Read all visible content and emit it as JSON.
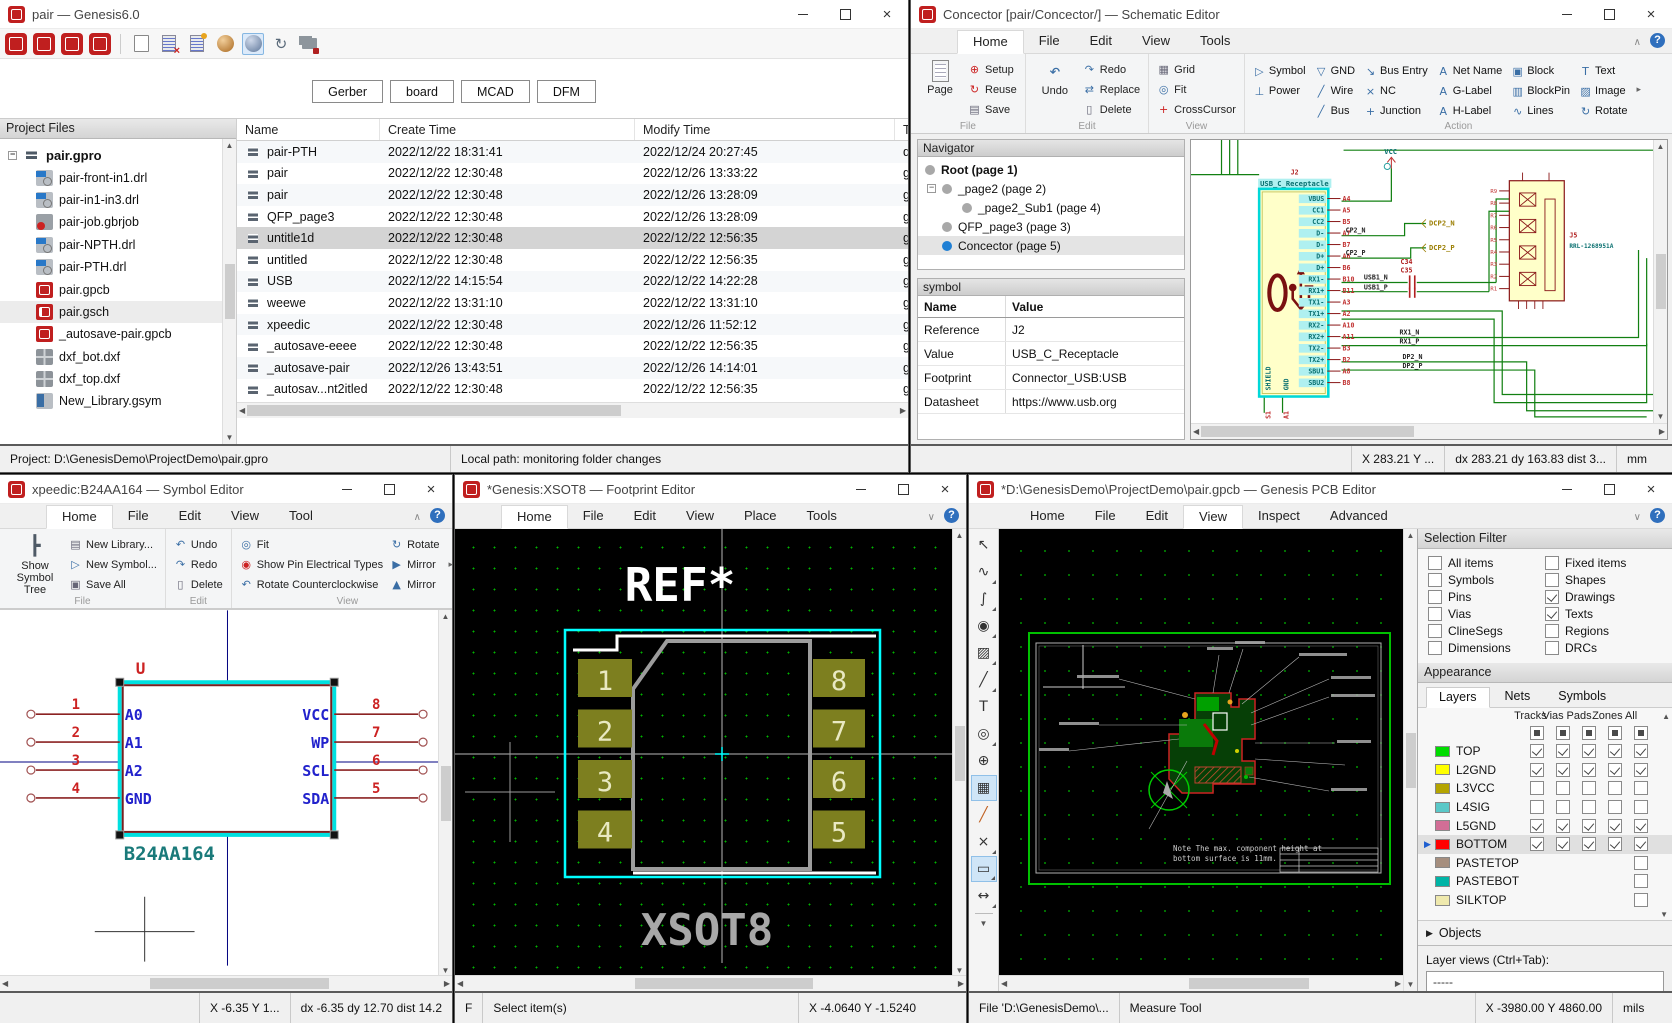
{
  "window_pm": {
    "title": "pair — Genesis6.0",
    "toolbar_actions": [
      "Gerber",
      "board",
      "MCAD",
      "DFM"
    ],
    "left_title": "Project Files",
    "tree": [
      {
        "label": "pair.gpro",
        "icon": "ti-root",
        "cls": "root"
      },
      {
        "label": "pair-front-in1.drl",
        "icon": "ti-drl"
      },
      {
        "label": "pair-in1-in3.drl",
        "icon": "ti-drl"
      },
      {
        "label": "pair-job.gbrjob",
        "icon": "ti-gbr"
      },
      {
        "label": "pair-NPTH.drl",
        "icon": "ti-drl"
      },
      {
        "label": "pair-PTH.drl",
        "icon": "ti-drl"
      },
      {
        "label": "pair.gpcb",
        "icon": "ti-gpcb"
      },
      {
        "label": "pair.gsch",
        "icon": "ti-gsch",
        "cls": "sel"
      },
      {
        "label": "_autosave-pair.gpcb",
        "icon": "ti-gpcb"
      },
      {
        "label": "dxf_bot.dxf",
        "icon": "ti-dxf"
      },
      {
        "label": "dxf_top.dxf",
        "icon": "ti-dxf"
      },
      {
        "label": "New_Library.gsym",
        "icon": "ti-gsym"
      }
    ],
    "table_headers": [
      "Name",
      "Create Time",
      "Modify Time",
      "Type"
    ],
    "table_rows": [
      {
        "name": "pair-PTH",
        "create": "2022/12/22 18:31:41",
        "modify": "2022/12/24 20:27:45",
        "type": "drl File"
      },
      {
        "name": "pair",
        "create": "2022/12/22 12:30:48",
        "modify": "2022/12/26 13:33:22",
        "type": "gpcb File"
      },
      {
        "name": "pair",
        "create": "2022/12/22 12:30:48",
        "modify": "2022/12/26 13:28:09",
        "type": "gsch File"
      },
      {
        "name": "QFP_page3",
        "create": "2022/12/22 12:30:48",
        "modify": "2022/12/26 13:28:09",
        "type": "gsch File"
      },
      {
        "name": "untitle1d",
        "create": "2022/12/22 12:30:48",
        "modify": "2022/12/22 12:56:35",
        "type": "gsch File",
        "cls": "sel"
      },
      {
        "name": "untitled",
        "create": "2022/12/22 12:30:48",
        "modify": "2022/12/22 12:56:35",
        "type": "gsch File"
      },
      {
        "name": "USB",
        "create": "2022/12/22 14:15:54",
        "modify": "2022/12/22 14:22:28",
        "type": "gsch File"
      },
      {
        "name": "weewe",
        "create": "2022/12/22 13:31:10",
        "modify": "2022/12/22 13:31:10",
        "type": "gftp File"
      },
      {
        "name": "xpeedic",
        "create": "2022/12/22 12:30:48",
        "modify": "2022/12/26 11:52:12",
        "type": "gsym File"
      },
      {
        "name": "_autosave-eeee",
        "create": "2022/12/22 12:30:48",
        "modify": "2022/12/22 12:56:35",
        "type": "gsch File"
      },
      {
        "name": "_autosave-pair",
        "create": "2022/12/26 13:43:51",
        "modify": "2022/12/26 14:14:01",
        "type": "gpcb File"
      },
      {
        "name": "_autosav...nt2itled",
        "create": "2022/12/22 12:30:48",
        "modify": "2022/12/22 12:56:35",
        "type": "gsch File"
      }
    ],
    "status_project": "Project: D:\\GenesisDemo\\ProjectDemo\\pair.gpro",
    "status_local": "Local path: monitoring folder changes"
  },
  "window_sch": {
    "title": "Concector [pair/Concector/] — Schematic Editor",
    "tabs": [
      {
        "label": "Home",
        "cls": "active"
      },
      {
        "label": "File"
      },
      {
        "label": "Edit"
      },
      {
        "label": "View"
      },
      {
        "label": "Tools"
      }
    ],
    "ribbon": {
      "page": "Page",
      "setup": "Setup",
      "reuse": "Reuse",
      "save": "Save",
      "file_group": "File",
      "undo": "Undo",
      "redo": "Redo",
      "replace": "Replace",
      "delete": "Delete",
      "edit_group": "Edit",
      "grid": "Grid",
      "fit": "Fit",
      "crosscursor": "CrossCursor",
      "view_group": "View",
      "action_items": [
        {
          "label": "Symbol",
          "g": "▷"
        },
        {
          "label": "Power",
          "g": "⊥",
          "cls": "ddm2"
        },
        {
          "label": "",
          "g": ""
        },
        {
          "label": "GND",
          "g": "▽",
          "cls": "ddm2"
        },
        {
          "label": "Wire",
          "g": "╱"
        },
        {
          "label": "Bus",
          "g": "╱"
        },
        {
          "label": "Bus Entry",
          "g": "↘"
        },
        {
          "label": "NC",
          "g": "×"
        },
        {
          "label": "Junction",
          "g": "+"
        },
        {
          "label": "Net Name",
          "g": "A"
        },
        {
          "label": "G-Label",
          "g": "A"
        },
        {
          "label": "H-Label",
          "g": "A"
        },
        {
          "label": "Block",
          "g": "▣"
        },
        {
          "label": "BlockPin",
          "g": "▥"
        },
        {
          "label": "Lines",
          "g": "∿"
        },
        {
          "label": "Text",
          "g": "T"
        },
        {
          "label": "Image",
          "g": "▨"
        },
        {
          "label": "Rotate",
          "g": "↻"
        }
      ],
      "action_group": "Action"
    },
    "navigator": {
      "title": "Navigator",
      "items": [
        {
          "label": "Root (page 1)",
          "cls": "bold"
        },
        {
          "label": "_page2 (page 2)",
          "cls": "ind1 exp"
        },
        {
          "label": "_page2_Sub1 (page 4)",
          "cls": "ind2"
        },
        {
          "label": "QFP_page3 (page 3)",
          "cls": "ind1"
        },
        {
          "label": "Concector (page 5)",
          "cls": "ind1 cur bluedot"
        }
      ]
    },
    "symbol_panel": {
      "title": "symbol",
      "col_name": "Name",
      "col_value": "Value",
      "rows": [
        {
          "name": "Reference",
          "value": "J2"
        },
        {
          "name": "Value",
          "value": "USB_C_Receptacle"
        },
        {
          "name": "Footprint",
          "value": "Connector_USB:USB"
        },
        {
          "name": "Datasheet",
          "value": "https://www.usb.org"
        }
      ]
    },
    "canvas": {
      "j2_ref": "J2",
      "j2_val": "USB_C_Receptacle",
      "j2_pins": [
        {
          "pad": "A4",
          "name": "VBUS"
        },
        {
          "pad": "A5",
          "name": "CC1"
        },
        {
          "pad": "B5",
          "name": "CC2"
        },
        {
          "pad": "A7",
          "name": "D-"
        },
        {
          "pad": "B7",
          "name": "D-"
        },
        {
          "pad": "A6",
          "name": "D+"
        },
        {
          "pad": "B6",
          "name": "D+"
        },
        {
          "pad": "B10",
          "name": "RX1-"
        },
        {
          "pad": "B11",
          "name": "RX1+"
        },
        {
          "pad": "A3",
          "name": "TX1-"
        },
        {
          "pad": "A2",
          "name": "TX1+"
        },
        {
          "pad": "A10",
          "name": "RX2-"
        },
        {
          "pad": "A11",
          "name": "RX2+"
        },
        {
          "pad": "B3",
          "name": "TX2-"
        },
        {
          "pad": "B2",
          "name": "TX2+"
        },
        {
          "pad": "A8",
          "name": "SBU1"
        },
        {
          "pad": "B8",
          "name": "SBU2"
        }
      ],
      "j2_left": [
        {
          "pad": "S1",
          "name": "SHIELD"
        },
        {
          "pad": "A1",
          "name": "GND"
        }
      ],
      "j5_pins": [
        "R9",
        "R8",
        "R7",
        "R6",
        "R5",
        "R4",
        "R3",
        "R2",
        "R1"
      ],
      "labels": {
        "vcc": "VCC",
        "cp2n": "CP2_N",
        "cp2p": "CP2_P",
        "gcp2n": "DCP2_N",
        "gcp2p": "DCP2_P",
        "c34": "C34",
        "c35": "C35",
        "usb1n": "USB1_N",
        "usb1p": "USB1_P",
        "rx1n": "RX1_N",
        "rx1p": "RX1_P",
        "dp2n": "DP2_N",
        "dp2p": "DP2_P",
        "j5": "J5",
        "j5val": "RRL-1268951A"
      }
    },
    "status": {
      "xy": "X 283.21  Y ...",
      "dxy": "dx 283.21  dy 163.83  dist 3...",
      "unit": "mm"
    }
  },
  "window_sym": {
    "title": "xpeedic:B24AA164 — Symbol Editor",
    "tabs": [
      {
        "label": "Home",
        "cls": "active"
      },
      {
        "label": "File"
      },
      {
        "label": "Edit"
      },
      {
        "label": "View"
      },
      {
        "label": "Tool"
      }
    ],
    "ribbon": {
      "show_tree": "Show Symbol Tree",
      "new_library": "New Library...",
      "new_symbol": "New Symbol...",
      "save_all": "Save All",
      "file_group": "File",
      "undo": "Undo",
      "redo": "Redo",
      "delete": "Delete",
      "edit_group": "Edit",
      "fit": "Fit",
      "pin_types": "Show Pin Electrical Types",
      "rotate_ccw": "Rotate Counterclockwise",
      "rotate": "Rotate",
      "mirror1": "Mirror",
      "mirror2": "Mirror",
      "view_group": "View"
    },
    "canvas": {
      "ref": "U",
      "value": "B24AA164",
      "pins_left": [
        {
          "num": "1",
          "name": "A0"
        },
        {
          "num": "2",
          "name": "A1"
        },
        {
          "num": "3",
          "name": "A2"
        },
        {
          "num": "4",
          "name": "GND"
        }
      ],
      "pins_right": [
        {
          "num": "8",
          "name": "VCC"
        },
        {
          "num": "7",
          "name": "WP"
        },
        {
          "num": "6",
          "name": "SCL"
        },
        {
          "num": "5",
          "name": "SDA"
        }
      ]
    },
    "status": {
      "xy": "X -6.35  Y 1...",
      "dxy": "dx -6.35  dy 12.70  dist 14.2"
    }
  },
  "window_fp": {
    "title": "*Genesis:XSOT8 — Footprint Editor",
    "tabs": [
      {
        "label": "Home",
        "cls": "active"
      },
      {
        "label": "File"
      },
      {
        "label": "Edit"
      },
      {
        "label": "View"
      },
      {
        "label": "Place"
      },
      {
        "label": "Tools"
      }
    ],
    "canvas": {
      "ref": "REF*",
      "name": "XSOT8",
      "pads_left": [
        "1",
        "2",
        "3",
        "4"
      ],
      "pads_right": [
        "8",
        "7",
        "6",
        "5"
      ]
    },
    "status": {
      "mode": "F",
      "msg": "Select item(s)",
      "xy": "X -4.0640  Y -1.5240"
    }
  },
  "window_pcb": {
    "title": "*D:\\GenesisDemo\\ProjectDemo\\pair.gpcb — Genesis PCB Editor",
    "tabs": [
      {
        "label": "Home"
      },
      {
        "label": "File"
      },
      {
        "label": "Edit"
      },
      {
        "label": "View",
        "cls": "active"
      },
      {
        "label": "Inspect"
      },
      {
        "label": "Advanced"
      }
    ],
    "tools": [
      {
        "n": "cursor-tool",
        "g": "↖"
      },
      {
        "n": "route-tool",
        "g": "∿",
        "cls": "dd"
      },
      {
        "n": "diffpair-tool",
        "g": "∫",
        "cls": "dd"
      },
      {
        "n": "via-tool",
        "g": "◉",
        "cls": "dd"
      },
      {
        "n": "zone-tool",
        "g": "▨",
        "cls": "dd"
      },
      {
        "n": "line-tool",
        "g": "╱",
        "cls": "dd"
      },
      {
        "n": "text-tool",
        "g": "T"
      },
      {
        "n": "zoom-tool",
        "g": "◎",
        "cls": "dd"
      },
      {
        "n": "pan-tool",
        "g": "⊕"
      },
      {
        "n": "grid-tool",
        "g": "▦",
        "cls": "on"
      },
      {
        "n": "color-pen-tool",
        "g": "╱",
        "cls": "pen"
      },
      {
        "n": "cut-tool",
        "g": "×",
        "cls": "dd"
      },
      {
        "n": "measure-tool",
        "g": "▭",
        "cls": "on dd"
      },
      {
        "n": "stretch-tool",
        "g": "↔",
        "cls": "dd"
      }
    ],
    "selection_filter": {
      "title": "Selection Filter",
      "items": [
        {
          "label": "All items"
        },
        {
          "label": "Fixed items"
        },
        {
          "label": "Symbols"
        },
        {
          "label": "Shapes"
        },
        {
          "label": "Pins"
        },
        {
          "label": "Drawings",
          "chk": "chk"
        },
        {
          "label": "Vias"
        },
        {
          "label": "Texts",
          "chk": "chk"
        },
        {
          "label": "ClineSegs"
        },
        {
          "label": "Regions"
        },
        {
          "label": "Dimensions"
        },
        {
          "label": "DRCs"
        }
      ]
    },
    "appearance": {
      "title": "Appearance",
      "tabs": [
        {
          "label": "Layers",
          "cls": "active"
        },
        {
          "label": "Nets"
        },
        {
          "label": "Symbols"
        }
      ],
      "col_headers": [
        "Tracks",
        "Vias",
        "Pads",
        "Zones",
        "All"
      ],
      "layers": [
        {
          "name": "TOP",
          "color": "#00dc00",
          "s0": "chk",
          "s1": "chk",
          "s2": "chk",
          "s3": "chk",
          "s4": "chk"
        },
        {
          "name": "L2GND",
          "color": "#ffff00",
          "s0": "chk",
          "s1": "chk",
          "s2": "chk",
          "s3": "chk",
          "s4": "chk"
        },
        {
          "name": "L3VCC",
          "color": "#b4a400",
          "s0": "unc",
          "s1": "unc",
          "s2": "unc",
          "s3": "unc",
          "s4": "unc"
        },
        {
          "name": "L4SIG",
          "color": "#5ac8c8",
          "s0": "unc",
          "s1": "unc",
          "s2": "unc",
          "s3": "unc",
          "s4": "unc"
        },
        {
          "name": "L5GND",
          "color": "#d26e96",
          "s0": "chk",
          "s1": "chk",
          "s2": "chk",
          "s3": "chk",
          "s4": "chk"
        },
        {
          "name": "BOTTOM",
          "color": "#ff0000",
          "cls": "cur",
          "s0": "chk",
          "s1": "chk",
          "s2": "chk",
          "s3": "chk",
          "s4": "chk"
        },
        {
          "name": "PASTETOP",
          "color": "#a58e7e",
          "s0": "non",
          "s1": "non",
          "s2": "non",
          "s3": "non",
          "s4": "unc"
        },
        {
          "name": "PASTEBOT",
          "color": "#00b4a6",
          "s0": "non",
          "s1": "non",
          "s2": "non",
          "s3": "non",
          "s4": "unc"
        },
        {
          "name": "SILKTOP",
          "color": "#efe9ad",
          "s0": "non",
          "s1": "non",
          "s2": "non",
          "s3": "non",
          "s4": "unc"
        }
      ],
      "objects": "Objects",
      "layer_views_label": "Layer views (Ctrl+Tab):",
      "layer_views_value": "-----"
    },
    "canvas": {
      "note1": "Note The max. component height at",
      "note2": "bottom surface is 11mm."
    },
    "status": {
      "file": "File 'D:\\GenesisDemo\\...",
      "tool": "Measure Tool",
      "xy": "X -3980.00  Y 4860.00",
      "unit": "mils"
    }
  }
}
